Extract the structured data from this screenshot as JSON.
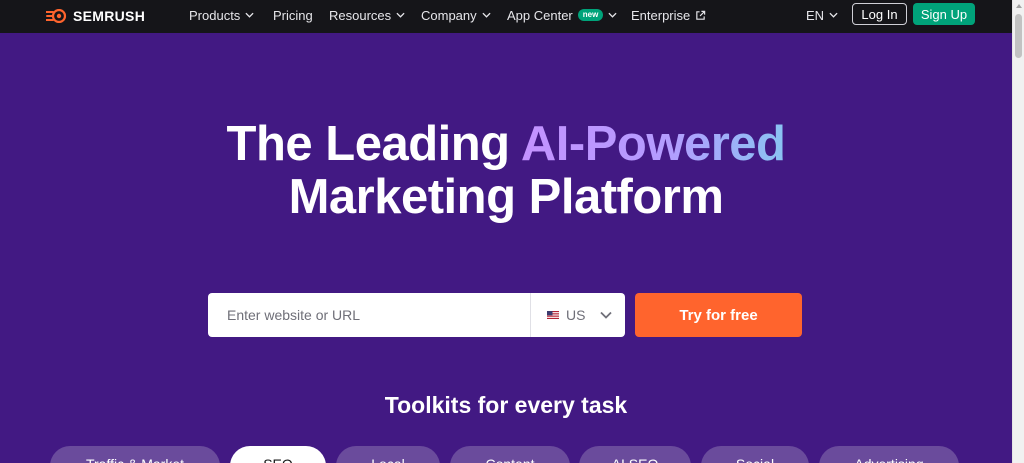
{
  "nav": {
    "logo_text": "SEMRUSH",
    "items": [
      {
        "label": "Products"
      },
      {
        "label": "Pricing"
      },
      {
        "label": "Resources"
      },
      {
        "label": "Company"
      },
      {
        "label": "App Center",
        "badge": "new"
      },
      {
        "label": "Enterprise"
      }
    ],
    "language": "EN",
    "login_label": "Log In",
    "signup_label": "Sign Up"
  },
  "hero": {
    "title_line1_plain": "The Leading ",
    "title_line1_highlight": "AI-Powered",
    "title_line2": "Marketing Platform",
    "search": {
      "placeholder": "Enter website or URL",
      "database": "US"
    },
    "cta_label": "Try for free"
  },
  "toolkits": {
    "heading": "Toolkits for every task",
    "pills": [
      {
        "label": "Traffic & Market"
      },
      {
        "label": "SEO",
        "active": true
      },
      {
        "label": "Local"
      },
      {
        "label": "Content"
      },
      {
        "label": "AI SEO"
      },
      {
        "label": "Social"
      },
      {
        "label": "Advertising"
      }
    ]
  },
  "colors": {
    "nav_bg": "#151519",
    "hero_bg": "#421983",
    "accent_orange": "#ff642d",
    "accent_green": "#00a37a",
    "pill_bg": "#6a4b9c"
  },
  "icons": {
    "logo": "semrush-fire-icon",
    "dropdown": "chevron-down-icon",
    "external": "external-link-icon",
    "flag": "us-flag-icon"
  }
}
